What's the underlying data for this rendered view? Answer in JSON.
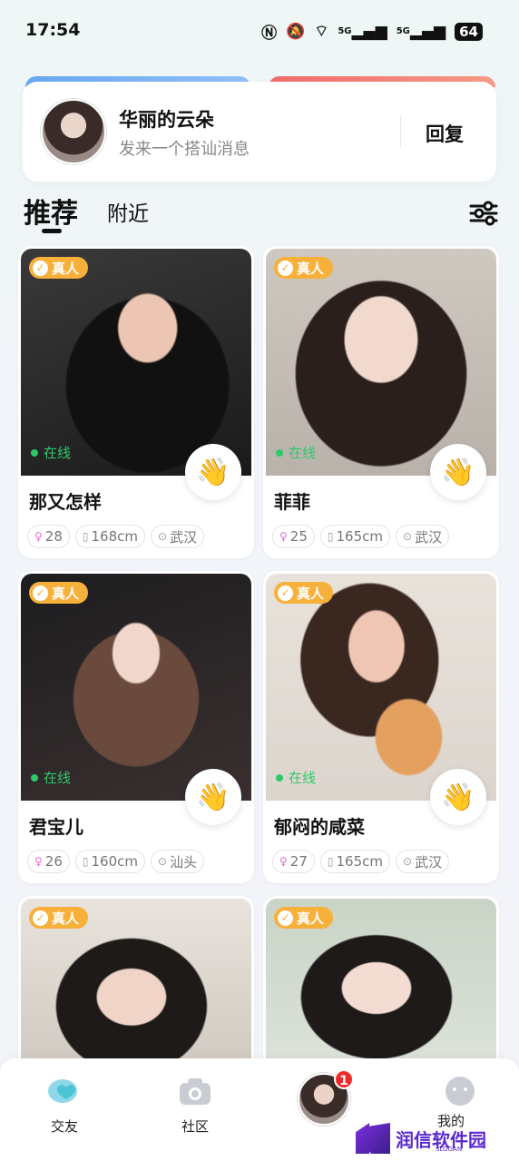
{
  "status_bar": {
    "time": "17:54",
    "signal1": "5G",
    "signal2": "5G",
    "battery": "64"
  },
  "notification": {
    "name": "华丽的云朵",
    "message": "发来一个搭讪消息",
    "reply_label": "回复"
  },
  "tabs": {
    "recommend": "推荐",
    "nearby": "附近"
  },
  "cards": [
    {
      "verified": "真人",
      "online": "在线",
      "name": "那又怎样",
      "age": "28",
      "height": "168cm",
      "city": "武汉"
    },
    {
      "verified": "真人",
      "online": "在线",
      "name": "菲菲",
      "age": "25",
      "height": "165cm",
      "city": "武汉"
    },
    {
      "verified": "真人",
      "online": "在线",
      "name": "君宝儿",
      "age": "26",
      "height": "160cm",
      "city": "汕头"
    },
    {
      "verified": "真人",
      "online": "在线",
      "name": "郁闷的咸菜",
      "age": "27",
      "height": "165cm",
      "city": "武汉"
    },
    {
      "verified": "真人"
    },
    {
      "verified": "真人"
    }
  ],
  "tabbar": {
    "friends": "交友",
    "community": "社区",
    "messages_badge": "1",
    "me": "我的"
  },
  "watermark": {
    "text": "润信软件园",
    "sub": "SLOGAN"
  },
  "colors": {
    "verified_badge": "#f7b03a",
    "online": "#2dc96b",
    "unread_badge": "#ef2a2a"
  }
}
